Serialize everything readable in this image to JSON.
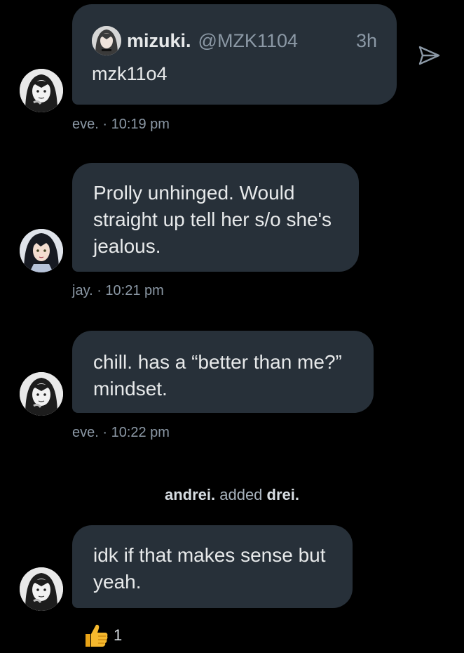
{
  "quote": {
    "author_name": "mizuki.",
    "author_handle": "@MZK1104",
    "time_ago": "3h",
    "body": "mzk11o4"
  },
  "messages": [
    {
      "sender_time": "eve. · 10:19 pm"
    },
    {
      "text": "Prolly unhinged. Would\nstraight up tell her s/o she's\njealous.",
      "sender_time": "jay. · 10:21 pm"
    },
    {
      "text": "chill. has a “better than me?”\nmindset.",
      "sender_time": "eve. · 10:22 pm"
    },
    {
      "text": "idk if that makes sense but\nyeah."
    }
  ],
  "system": {
    "actor": "andrei.",
    "action": "added",
    "target": "drei."
  },
  "reaction": {
    "emoji_icon": "thumbs-up-icon",
    "count": "1"
  },
  "colors": {
    "background": "#000000",
    "bubble": "#273039",
    "meta": "#8b98a5"
  }
}
